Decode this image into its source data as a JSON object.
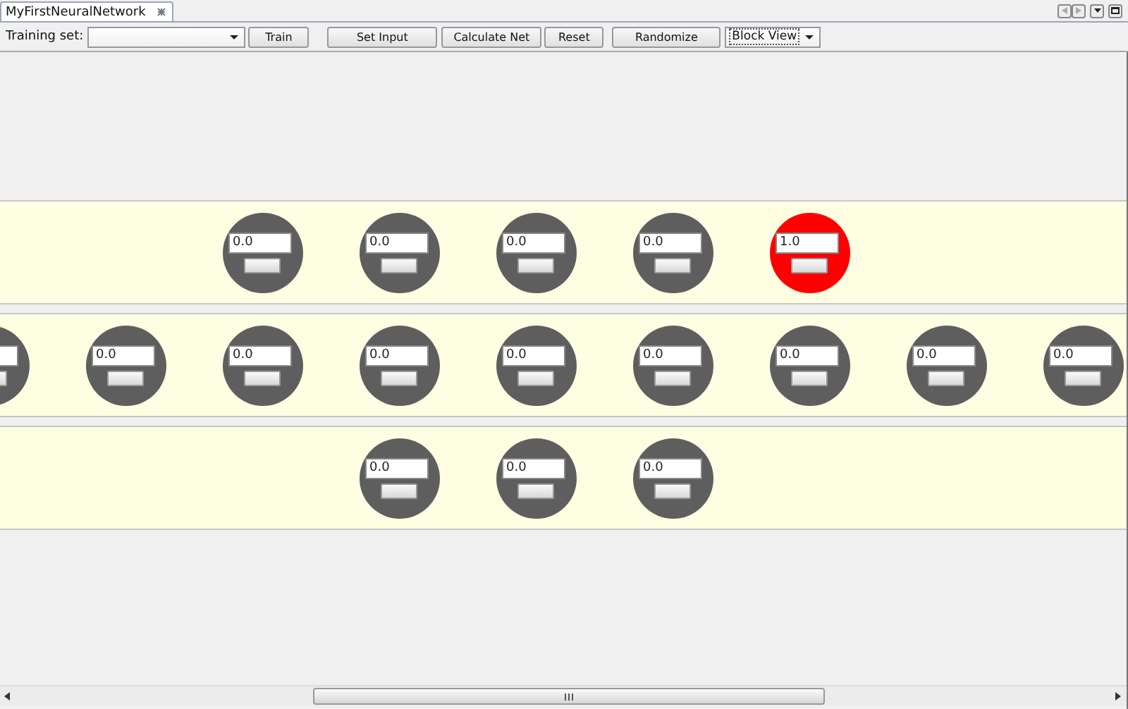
{
  "tab": {
    "title": "MyFirstNeuralNetwork",
    "selected": true
  },
  "toolbar": {
    "training_set_label": "Training set:",
    "buttons": [
      "Train",
      "Set Input",
      "Calculate Net",
      "Reset",
      "Randomize"
    ],
    "view": {
      "value": "Block View"
    }
  },
  "layers": [
    {
      "neurons": [
        {
          "value": "0.0",
          "active": false
        },
        {
          "value": "0.0",
          "active": false
        },
        {
          "value": "0.0",
          "active": false
        },
        {
          "value": "0.0",
          "active": false
        },
        {
          "value": "1.0",
          "active": true
        }
      ]
    },
    {
      "neurons": [
        {
          "active": false
        },
        {
          "value": "0.0",
          "active": false
        },
        {
          "value": "0.0",
          "active": false
        },
        {
          "value": "0.0",
          "active": false
        },
        {
          "value": "0.0",
          "active": false
        },
        {
          "value": "0.0",
          "active": false
        },
        {
          "value": "0.0",
          "active": false
        },
        {
          "value": "0.0",
          "active": false
        },
        {
          "value": "0.0",
          "active": false
        }
      ]
    },
    {
      "neurons": [
        {
          "value": "0.0",
          "active": false
        },
        {
          "value": "0.0",
          "active": false
        },
        {
          "value": "0.0",
          "active": false
        }
      ]
    }
  ]
}
